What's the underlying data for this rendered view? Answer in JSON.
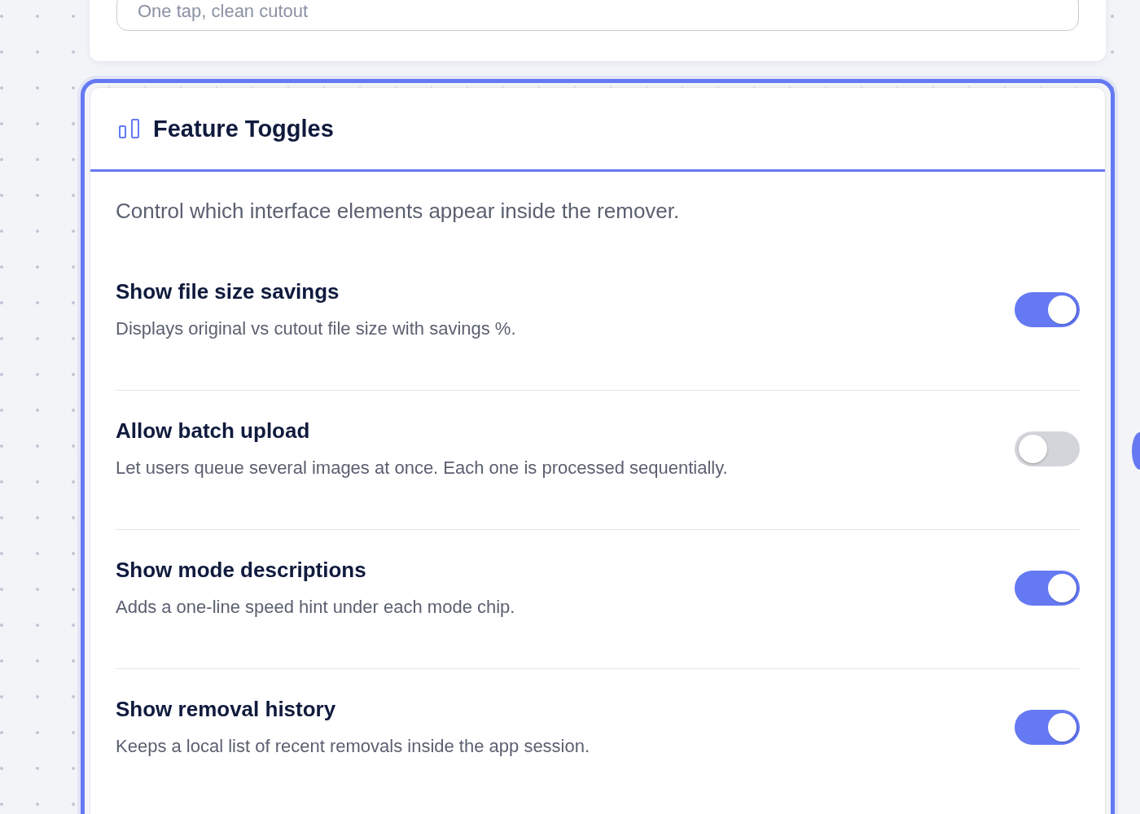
{
  "tagline_field": {
    "value": "One tap, clean cutout"
  },
  "feature_toggles": {
    "title": "Feature Toggles",
    "description": "Control which interface elements appear inside the remover.",
    "toggles": [
      {
        "label": "Show file size savings",
        "description": "Displays original vs cutout file size with savings %.",
        "on": true
      },
      {
        "label": "Allow batch upload",
        "description": "Let users queue several images at once. Each one is processed sequentially.",
        "on": false
      },
      {
        "label": "Show mode descriptions",
        "description": "Adds a one-line speed hint under each mode chip.",
        "on": true
      },
      {
        "label": "Show removal history",
        "description": "Keeps a local list of recent removals inside the app session.",
        "on": true
      }
    ]
  }
}
